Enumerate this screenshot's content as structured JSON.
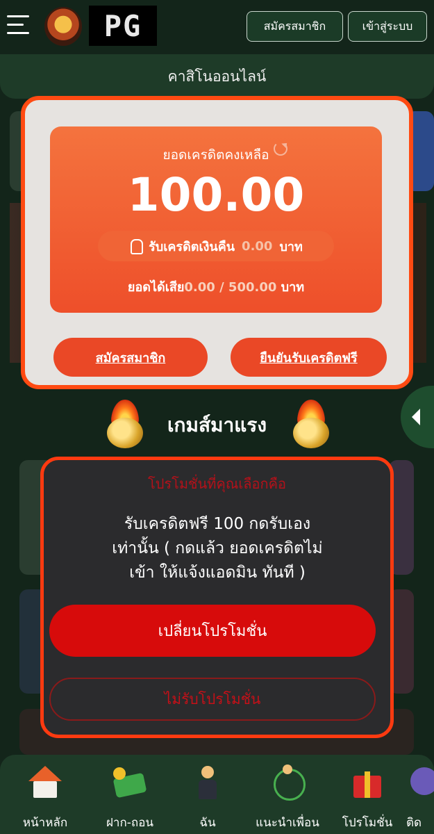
{
  "header": {
    "logo_text": "PG",
    "register_label": "สมัครสมาชิก",
    "login_label": "เข้าสู่ระบบ",
    "casino_label": "คาสิโนออนไลน์"
  },
  "section": {
    "hot_games_title": "เกมส์มาแรง"
  },
  "credit_modal": {
    "label": "ยอดเครดิตคงเหลือ",
    "amount": "100.00",
    "cashback_label": "รับเครดิตเงินคืน",
    "cashback_value": "0.00",
    "cashback_unit": "บาท",
    "turnover_label": "ยอดได้เสีย",
    "turnover_value": "0.00 / 500.00",
    "turnover_unit": "บาท",
    "register_button": "สมัครสมาชิก",
    "confirm_button": "ยืนยันรับเครดิตฟรี"
  },
  "promo_modal": {
    "heading": "โปรโมชั่นที่คุณเลือกคือ",
    "body_line1": "รับเครดิตฟรี 100 กดรับเอง",
    "body_line2": "เท่านั้น ( กดแล้ว ยอดเครดิตไม่",
    "body_line3": "เข้า ให้แจ้งแอดมิน ทันที )",
    "change_button": "เปลี่ยนโปรโมชั่น",
    "decline_button": "ไม่รับโปรโมชั่น"
  },
  "bottom_nav": {
    "items": [
      {
        "label": "หน้าหลัก",
        "icon": "home-icon"
      },
      {
        "label": "ฝาก-ถอน",
        "icon": "money-icon"
      },
      {
        "label": "ฉัน",
        "icon": "person-icon"
      },
      {
        "label": "แนะนำเพื่อน",
        "icon": "friends-icon"
      },
      {
        "label": "โปรโมชั่น",
        "icon": "gift-icon"
      },
      {
        "label": "ติด",
        "icon": "contact-icon"
      }
    ]
  },
  "colors": {
    "background": "#13251a",
    "accent": "#ff4a12",
    "credit_card": "#ee4f2a",
    "promo_button": "#d70b0b"
  }
}
